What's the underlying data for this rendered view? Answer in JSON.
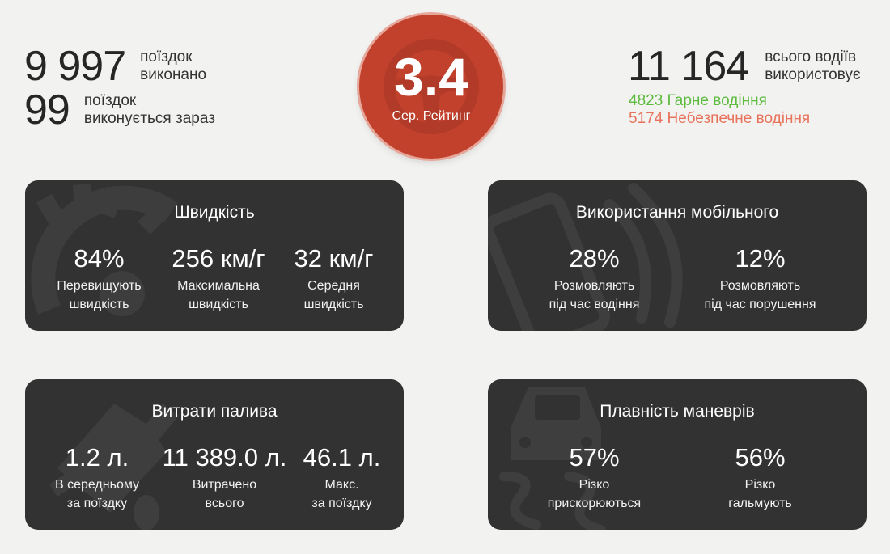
{
  "summary": {
    "trips_completed": {
      "value": "9 997",
      "label_line1": "поїздок",
      "label_line2": "виконано"
    },
    "trips_in_progress": {
      "value": "99",
      "label_line1": "поїздок",
      "label_line2": "виконується зараз"
    },
    "drivers_total": {
      "value": "11 164",
      "label_line1": "всього водіїв",
      "label_line2": "використовує"
    },
    "good_driving": "4823 Гарне водіння",
    "dangerous_driving": "5174 Небезпечне водіння"
  },
  "rating": {
    "value": "3.4",
    "caption": "Сер. Рейтинг",
    "icon": "steering-wheel-icon"
  },
  "cards": {
    "speed": {
      "title": "Швидкість",
      "icon": "speedometer-icon",
      "metrics": [
        {
          "value": "84%",
          "line1": "Перевищують",
          "line2": "швидкість"
        },
        {
          "value": "256 км/г",
          "line1": "Максимальна",
          "line2": "швидкість"
        },
        {
          "value": "32 км/г",
          "line1": "Середня",
          "line2": "швидкість"
        }
      ]
    },
    "mobile": {
      "title": "Використання мобільного",
      "icon": "phone-icon",
      "metrics": [
        {
          "value": "28%",
          "line1": "Розмовляють",
          "line2": "під час водіння"
        },
        {
          "value": "12%",
          "line1": "Розмовляють",
          "line2": "під час порушення"
        }
      ]
    },
    "fuel": {
      "title": "Витрати палива",
      "icon": "fuel-nozzle-icon",
      "metrics": [
        {
          "value": "1.2 л.",
          "line1": "В середньому",
          "line2": "за поїздку"
        },
        {
          "value": "11 389.0 л.",
          "line1": "Витрачено",
          "line2": "всього"
        },
        {
          "value": "46.1 л.",
          "line1": "Макс.",
          "line2": "за поїздку"
        }
      ]
    },
    "smoothness": {
      "title": "Плавність маневрів",
      "icon": "skidding-car-icon",
      "metrics": [
        {
          "value": "57%",
          "line1": "Різко",
          "line2": "прискорюються"
        },
        {
          "value": "56%",
          "line1": "Різко",
          "line2": "гальмують"
        }
      ]
    }
  },
  "colors": {
    "background": "#f2f2f0",
    "card": "#323232",
    "rating": "#c2412d",
    "good": "#5dbb3f",
    "bad": "#e8735c"
  }
}
